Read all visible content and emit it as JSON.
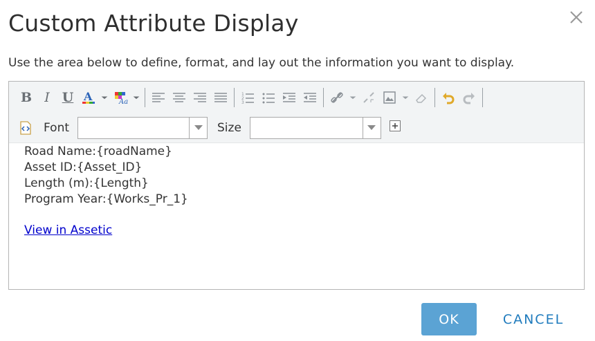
{
  "dialog": {
    "title": "Custom Attribute Display",
    "description": "Use the area below to define, format, and lay out the information you want to display."
  },
  "toolbar": {
    "bold_label": "B",
    "italic_label": "I",
    "underline_label": "U",
    "font_text_color_glyph": "A",
    "font_label": "Font",
    "font_value": "",
    "size_label": "Size",
    "size_value": "",
    "icons": [
      "bold",
      "italic",
      "underline",
      "font-color-icon",
      "highlight-color-icon",
      "align-left-icon",
      "align-center-icon",
      "align-right-icon",
      "justify-icon",
      "numbered-list-icon",
      "bullet-list-icon",
      "indent-icon",
      "outdent-icon",
      "link-icon",
      "unlink-icon",
      "insert-image-icon",
      "eraser-icon",
      "undo-icon",
      "redo-icon",
      "source-view-icon",
      "expand-plus-icon"
    ]
  },
  "content": {
    "lines": [
      "Road Name:{roadName}",
      "Asset ID:{Asset_ID}",
      "Length (m):{Length}",
      "Program Year:{Works_Pr_1}"
    ],
    "link_text": "View in Assetic"
  },
  "buttons": {
    "ok": "OK",
    "cancel": "CANCEL"
  },
  "colors": {
    "ok_background": "#5ba3d4",
    "cancel_text": "#1f7bbd",
    "link": "#0000cc",
    "toolbar_background": "#f2f4f5"
  }
}
